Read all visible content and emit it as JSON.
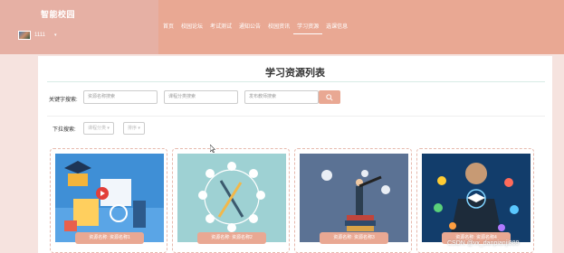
{
  "header": {
    "brand": "智能校园",
    "user": "1111",
    "nav": [
      {
        "label": "首页",
        "active": false
      },
      {
        "label": "校园论坛",
        "active": false
      },
      {
        "label": "考试测试",
        "active": false
      },
      {
        "label": "通知公告",
        "active": false
      },
      {
        "label": "校园资讯",
        "active": false
      },
      {
        "label": "学习资源",
        "active": true
      },
      {
        "label": "选课信息",
        "active": false
      }
    ]
  },
  "main": {
    "title": "学习资源列表",
    "search": {
      "label": "关键字搜索:",
      "placeholder_name": "资源名称搜索",
      "placeholder_category": "课程分类搜索",
      "placeholder_teacher": "发布教师搜索"
    },
    "filters": {
      "label": "下拉搜索:",
      "category": "课程分类",
      "sort": "排序"
    },
    "cards": [
      {
        "caption": "资源名称: 资源名称1"
      },
      {
        "caption": "资源名称: 资源名称2"
      },
      {
        "caption": "资源名称: 资源名称3"
      },
      {
        "caption": "资源名称: 资源名称4"
      }
    ]
  },
  "watermark": "CSDN @vx_danpianji889",
  "colors": {
    "accent": "#e9a893",
    "header_bg": "#e9a893",
    "page_bg": "#f6e3df"
  }
}
